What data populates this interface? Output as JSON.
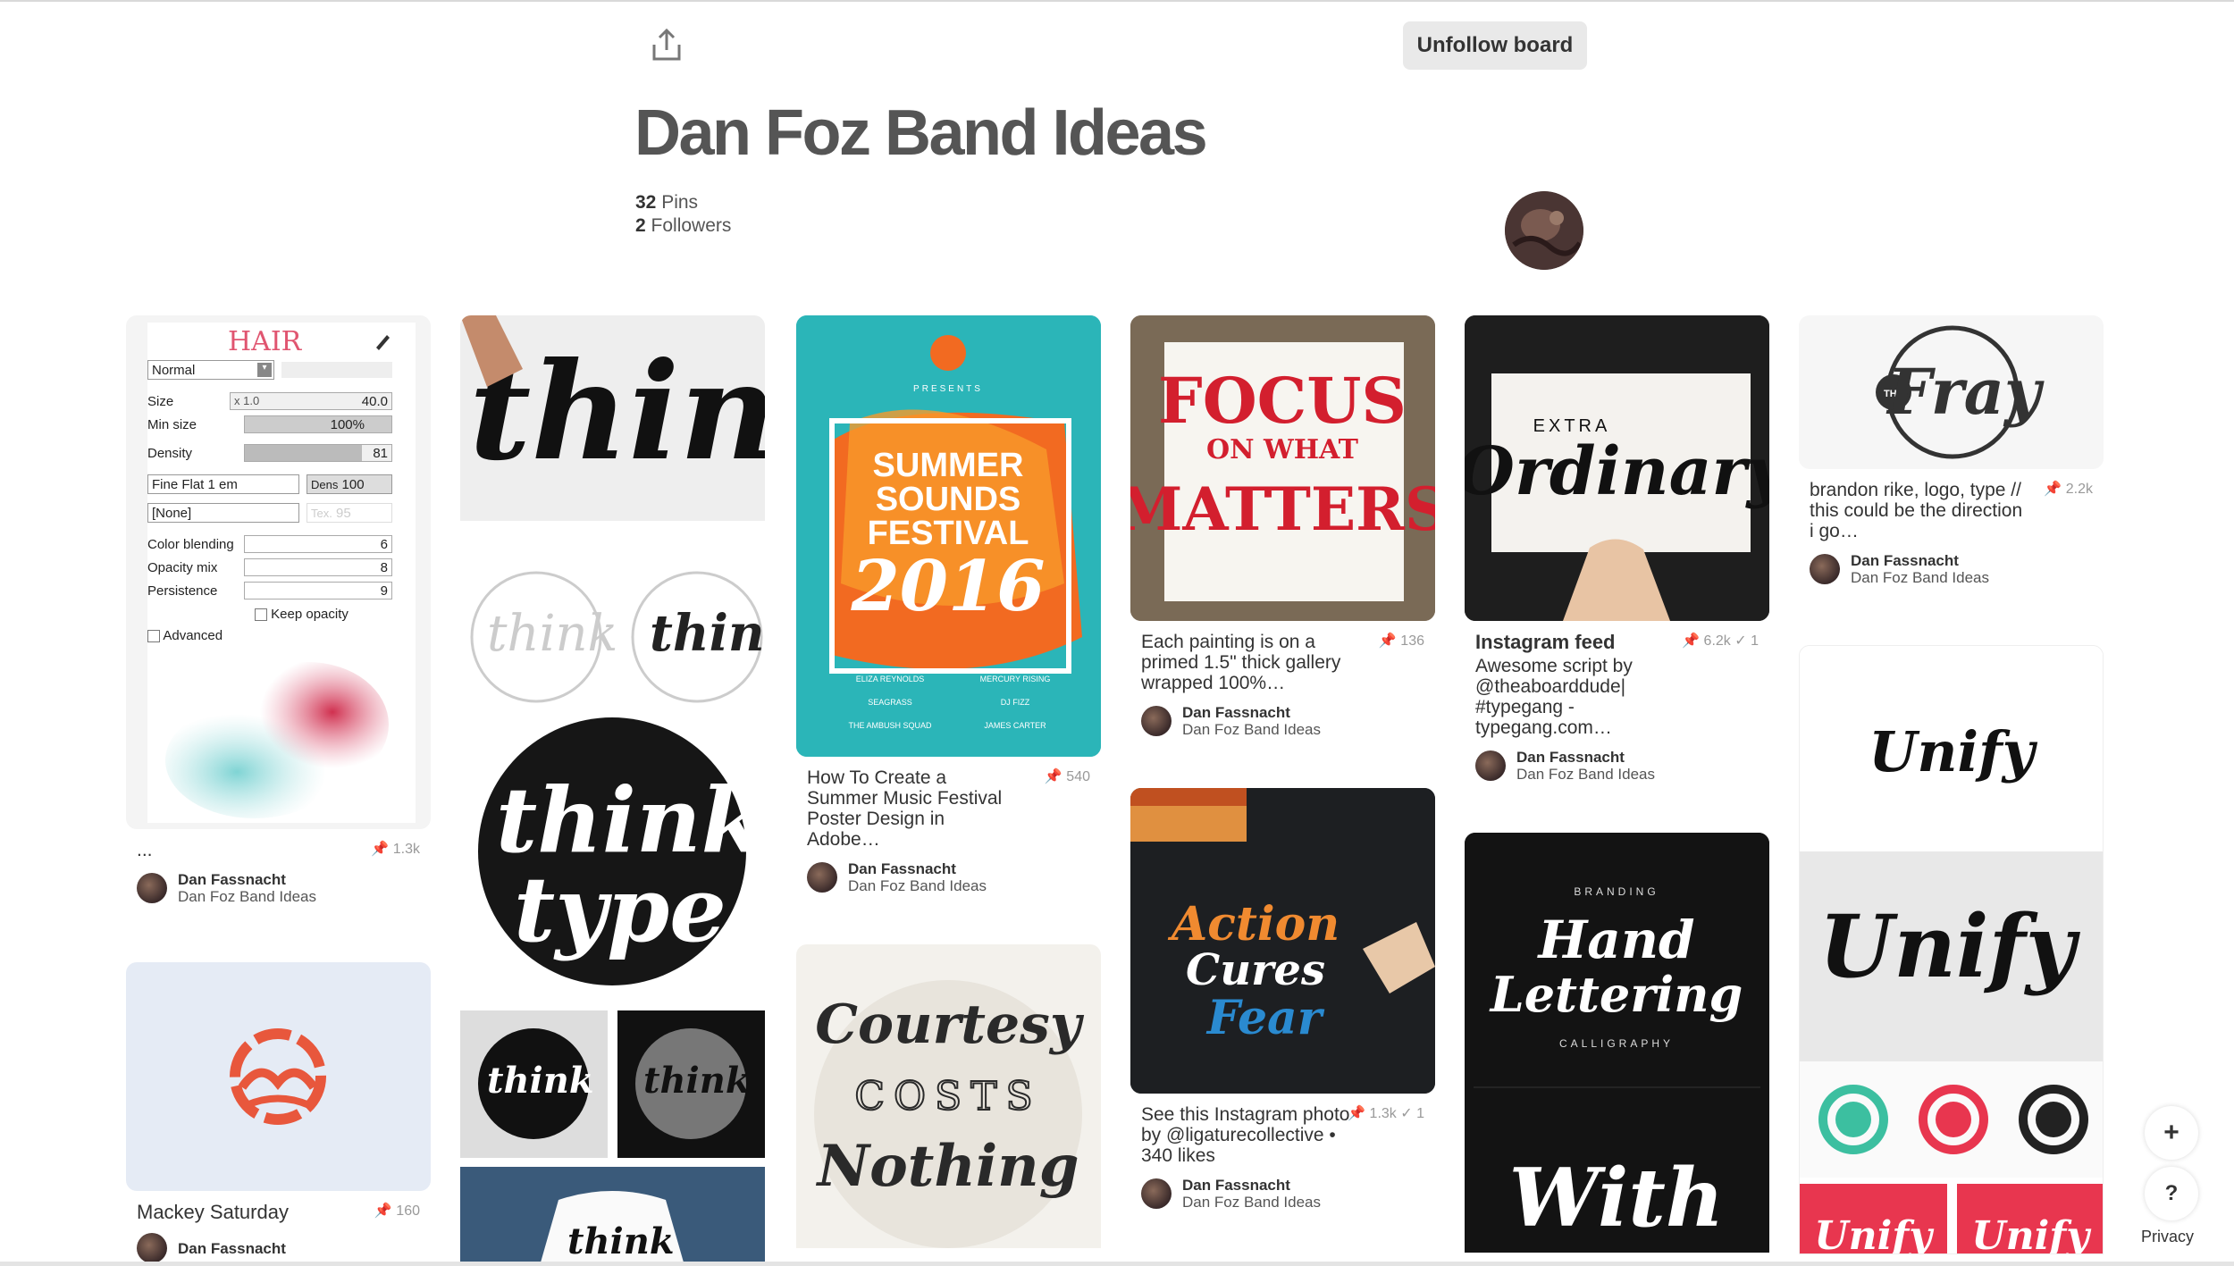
{
  "header": {
    "unfollow_label": "Unfollow board",
    "board_title": "Dan Foz Band Ideas",
    "pins_count": "32",
    "pins_label": "Pins",
    "followers_count": "2",
    "followers_label": "Followers"
  },
  "pins": {
    "hair": {
      "description": "...",
      "repins": "1.3k",
      "pinner": "Dan Fassnacht",
      "board": "Dan Foz Band Ideas",
      "panel": {
        "title": "HAIR",
        "mode": "Normal",
        "size_label": "Size",
        "size_mult": "x 1.0",
        "size_value": "40.0",
        "minsize_label": "Min size",
        "minsize_value": "100%",
        "density_label": "Density",
        "density_value": "81",
        "texture": "Fine Flat 1 em",
        "dens_label": "Dens",
        "dens_value": "100",
        "none_option": "[None]",
        "tex_label": "Tex.",
        "tex_value": "95",
        "blend_label": "Color blending",
        "blend_value": "6",
        "opacity_label": "Opacity mix",
        "opacity_value": "8",
        "persist_label": "Persistence",
        "persist_value": "9",
        "keep_opacity": "Keep opacity",
        "advanced": "Advanced"
      }
    },
    "mackey": {
      "description": "Mackey Saturday",
      "repins": "160",
      "pinner": "Dan Fassnacht"
    },
    "summer": {
      "description": "How To Create a Summer Music Festival Poster Design in Adobe…",
      "repins": "540",
      "pinner": "Dan Fassnacht",
      "board": "Dan Foz Band Ideas",
      "poster": {
        "presents": "PRESENTS",
        "line1": "SUMMER",
        "line2": "SOUNDS",
        "line3": "FESTIVAL",
        "year": "2016",
        "acts": [
          "ELIZA REYNOLDS",
          "MERCURY RISING",
          "SEAGRASS",
          "DJ FIZZ",
          "THE AMBUSH SQUAD",
          "JAMES CARTER"
        ]
      }
    },
    "focus": {
      "description": "Each painting is on a primed 1.5\" thick gallery wrapped 100%…",
      "repins": "136",
      "pinner": "Dan Fassnacht",
      "board": "Dan Foz Band Ideas",
      "art": {
        "line1": "FOCUS",
        "line2": "ON WHAT",
        "line3": "MATTERS"
      }
    },
    "action": {
      "description": "See this Instagram photo by @ligaturecollective • 340 likes",
      "repins": "1.3k",
      "checks": "1",
      "pinner": "Dan Fassnacht",
      "board": "Dan Foz Band Ideas",
      "art": {
        "line1": "Action",
        "line2": "Cures",
        "line3": "Fear"
      }
    },
    "ordinary": {
      "title": "Instagram feed",
      "description": "Awesome script by @theaboarddude| #typegang - typegang.com…",
      "repins": "6.2k",
      "checks": "1",
      "pinner": "Dan Fassnacht",
      "board": "Dan Foz Band Ideas",
      "art": {
        "small": "EXTRA",
        "script": "Ordinary"
      }
    },
    "hand": {
      "art": {
        "top": "BRANDING",
        "line1": "Hand",
        "line2": "Lettering",
        "bottom": "CALLIGRAPHY",
        "next": "With"
      }
    },
    "fray": {
      "description": "brandon rike, logo, type // this could be the direction i go…",
      "repins": "2.2k",
      "pinner": "Dan Fassnacht",
      "board": "Dan Foz Band Ideas",
      "art": {
        "small": "THE",
        "script": "Fray"
      }
    },
    "unify": {
      "art": {
        "word": "Unify"
      }
    },
    "think": {
      "art": {
        "w1": "think",
        "w2": "type"
      }
    },
    "courtesy": {
      "art": {
        "line1": "Courtesy",
        "line2": "COSTS",
        "line3": "Nothing"
      }
    }
  },
  "floating": {
    "add": "+",
    "help": "?",
    "privacy": "Privacy"
  },
  "colors": {
    "accent_red": "#e60023",
    "summer_bg": "#2bb5b8",
    "summer_orange": "#f26a21",
    "mackey_orange": "#e8573c",
    "unify_red": "#e8364f"
  }
}
